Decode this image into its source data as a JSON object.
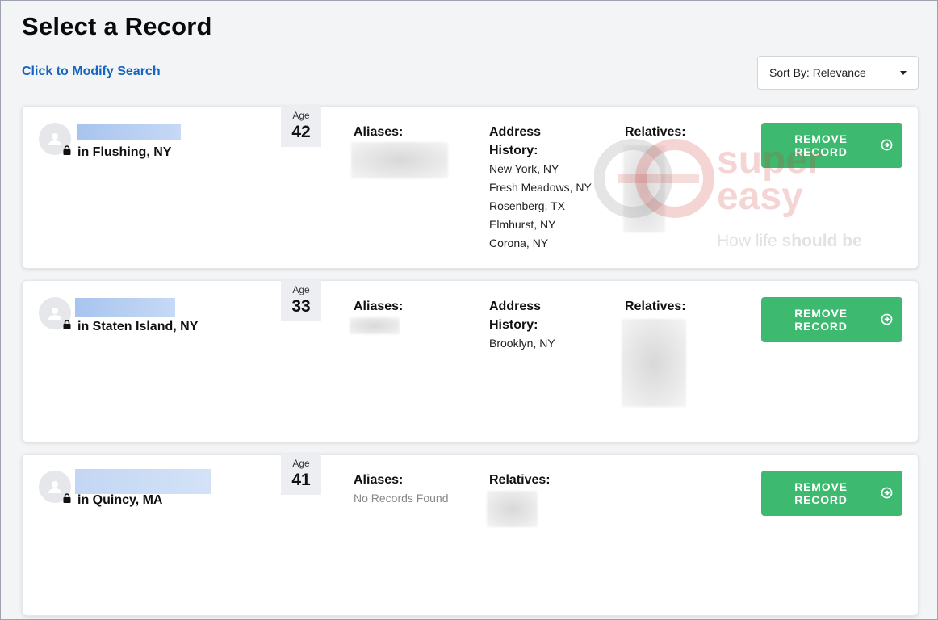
{
  "page": {
    "title": "Select a Record",
    "modify_link": "Click to Modify Search",
    "sort": {
      "prefix": "Sort By:",
      "value": "Relevance"
    }
  },
  "labels": {
    "age": "Age",
    "aliases": "Aliases:",
    "address_history_line1": "Address",
    "address_history_line2": "History:",
    "relatives": "Relatives:",
    "remove_line1": "REMOVE",
    "remove_line2": "RECORD"
  },
  "records": [
    {
      "location": "in Flushing, NY",
      "age": "42",
      "addresses": [
        "New York, NY",
        "Fresh Meadows, NY",
        "Rosenberg, TX",
        "Elmhurst, NY",
        "Corona, NY"
      ]
    },
    {
      "location": "in Staten Island, NY",
      "age": "33",
      "addresses": [
        "Brooklyn, NY"
      ]
    },
    {
      "location": "in Quincy, MA",
      "age": "41",
      "aliases_text": "No Records Found"
    }
  ],
  "watermark": {
    "line1": "super",
    "line2": "easy",
    "tagline_pre": "How life ",
    "tagline_bold": "should be"
  },
  "colors": {
    "accent_green": "#3dba6f",
    "link_blue": "#1565c0",
    "background": "#f3f4f6"
  },
  "icons": [
    "person-icon",
    "lock-icon",
    "arrow-circle-right-icon",
    "caret-down-icon"
  ]
}
